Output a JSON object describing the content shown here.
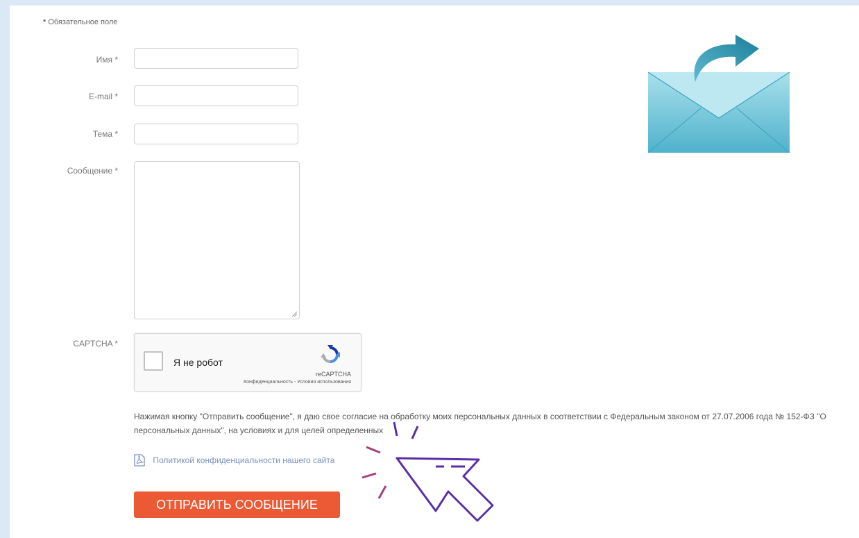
{
  "form": {
    "required_note": "Обязательное поле",
    "required_mark": "*",
    "fields": {
      "name_label": "Имя *",
      "email_label": "E-mail *",
      "subject_label": "Тема *",
      "message_label": "Сообщение *",
      "captcha_label": "CAPTCHA *"
    },
    "captcha": {
      "checkbox_label": "Я не робот",
      "brand": "reCAPTCHA",
      "terms": "Конфиденциальность - Условия использования"
    },
    "consent_line1": "Нажимая кнопку \"Отправить сообщение\", я даю свое согласие на обработку моих персональных данных в соответствии с Федеральным законом от 27.07.2006 года № 152-ФЗ \"О",
    "consent_line2": "персональных данных\", на условиях и для целей определенных",
    "policy_link": "Политикой конфиденциальности нашего сайта",
    "submit_label": "ОТПРАВИТЬ СООБЩЕНИЕ"
  },
  "icons": {
    "envelope": "envelope-send-icon",
    "pdf": "pdf-icon",
    "cursor": "click-cursor-icon",
    "recaptcha": "recaptcha-logo-icon"
  },
  "colors": {
    "submit": "#ec5a35",
    "envelope": "#6fc3d6",
    "cursor": "#5a2fa6",
    "link": "#7a8fc0"
  }
}
